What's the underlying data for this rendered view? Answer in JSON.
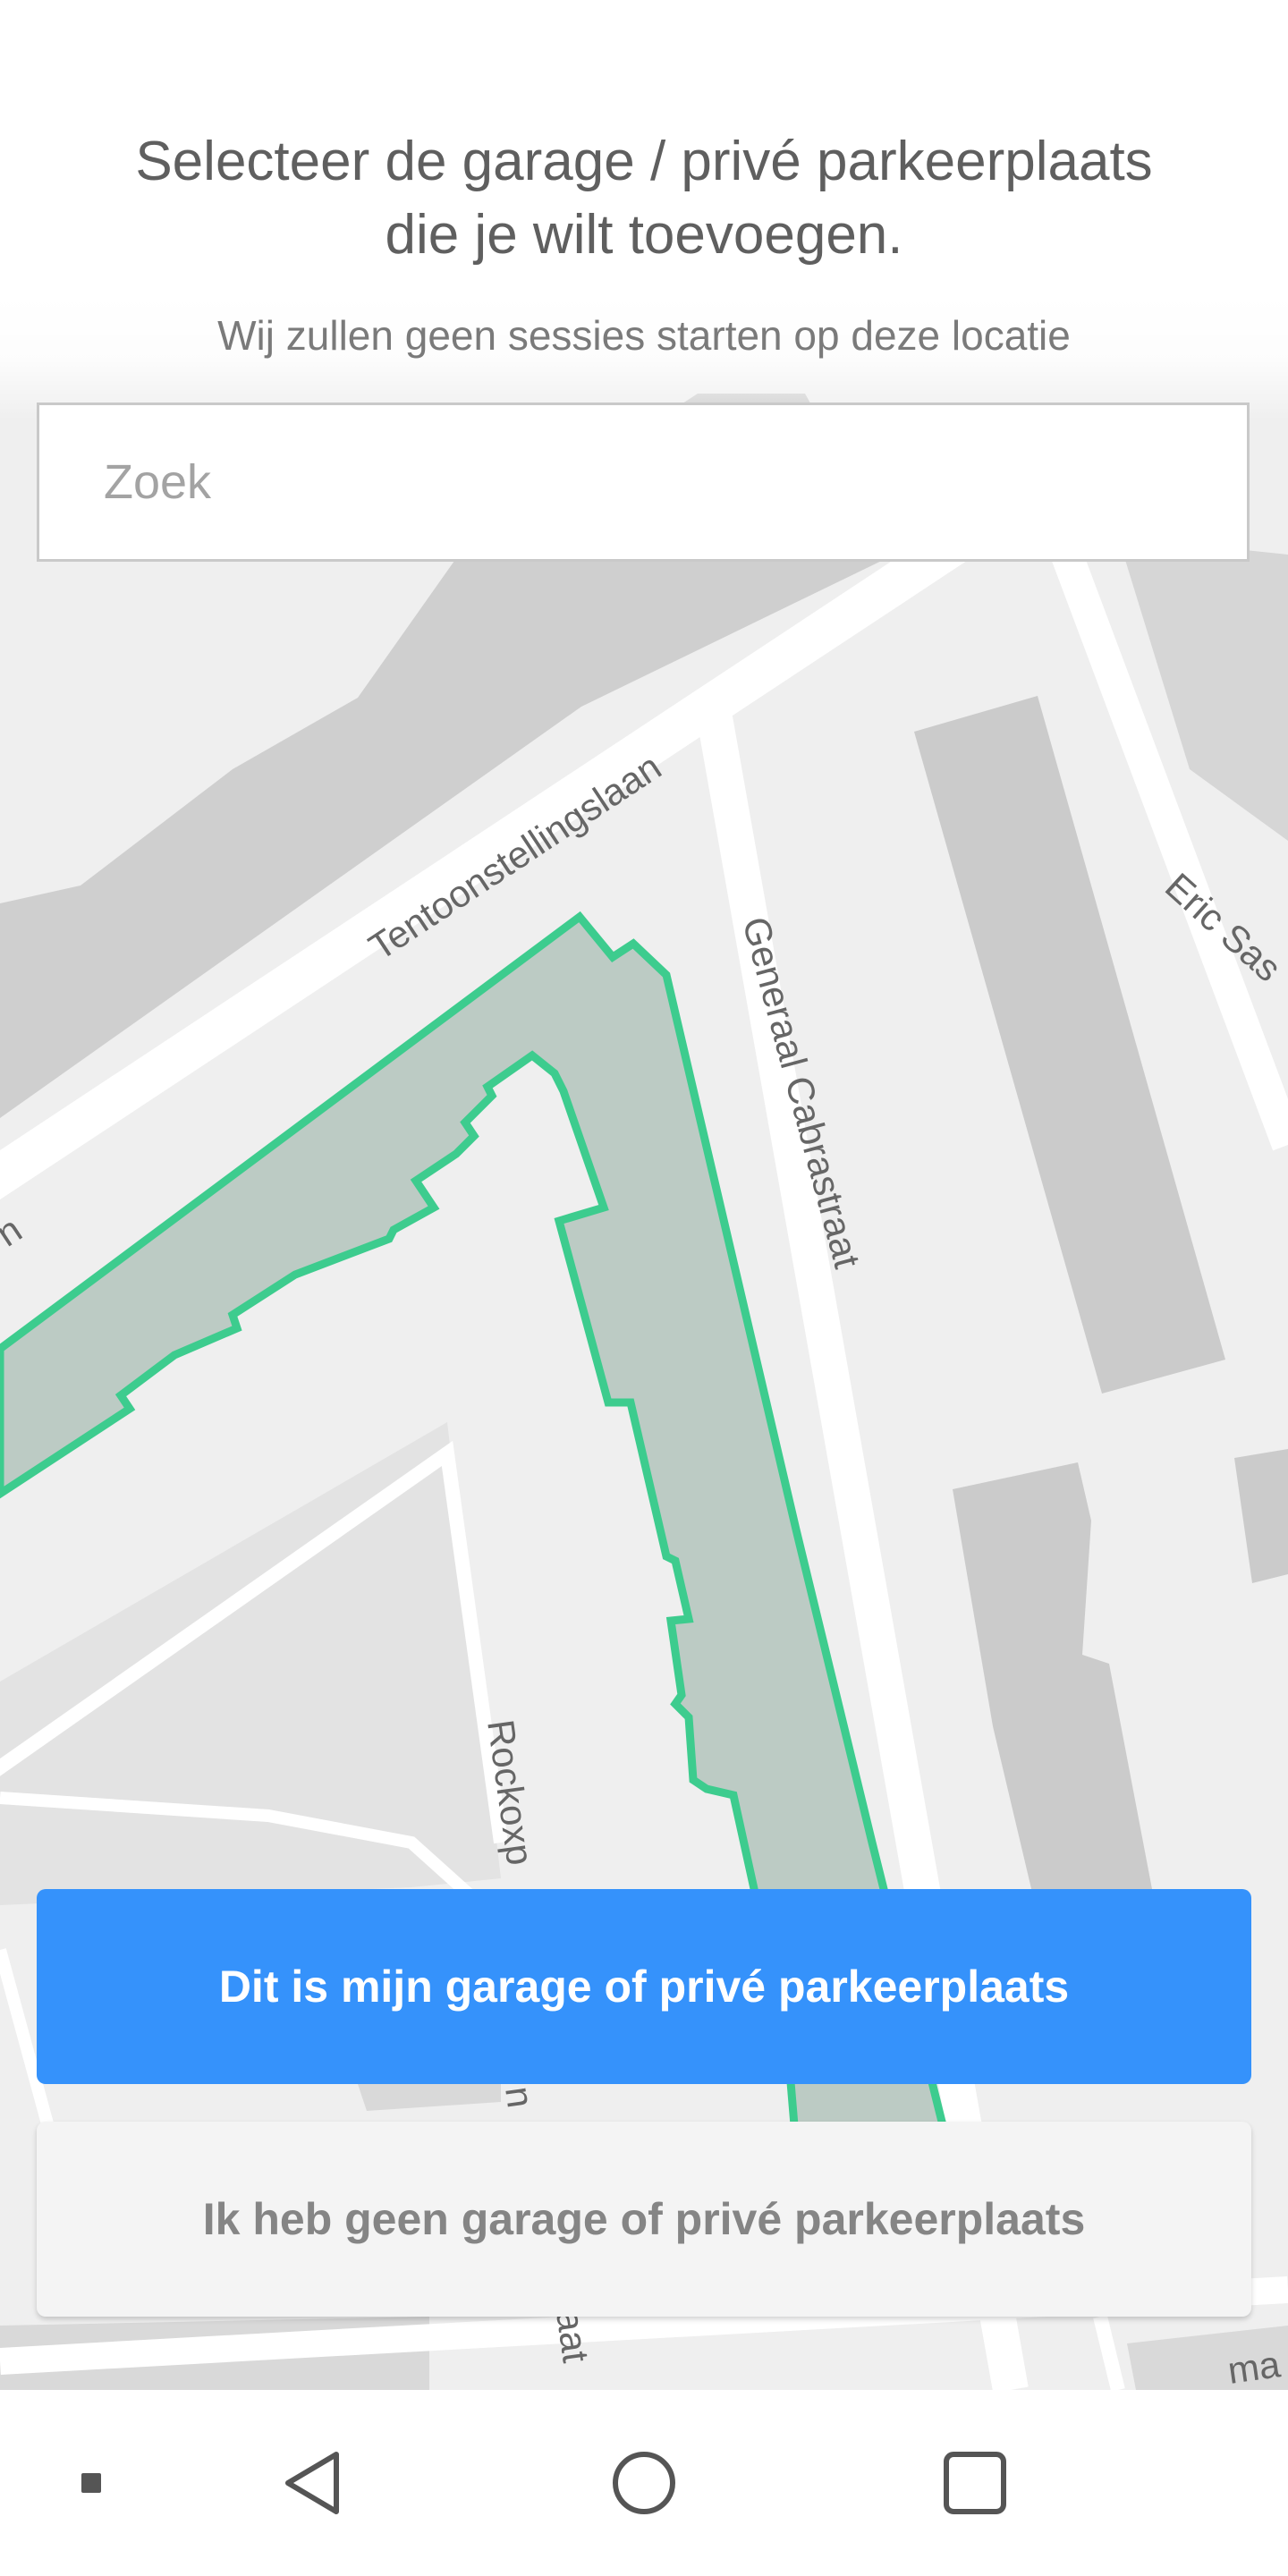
{
  "header": {
    "title_line1": "Selecteer de garage / privé parkeerplaats",
    "title_line2": "die je wilt toevoegen.",
    "subtitle": "Wij zullen geen sessies starten op deze locatie"
  },
  "search": {
    "placeholder": "Zoek",
    "value": ""
  },
  "map": {
    "streets": {
      "tentoonstellingslaan": "Tentoonstellingslaan",
      "generaal_cabrastraat": "Generaal Cabrastraat",
      "eric_sas": "Eric Sas",
      "rockoxp": "Rockoxp",
      "left_fragment": "n",
      "bottom_fragment_1": "n",
      "bottom_fragment_2": "aat",
      "right_bottom_fragment": "ma"
    },
    "colors": {
      "selection_outline": "#3dcc8e",
      "selection_fill": "#bccbc4",
      "marker": "#3592fb",
      "building": "#cfcfcf",
      "road": "#ffffff"
    },
    "marker_icon": "garage-car-icon"
  },
  "actions": {
    "primary_label": "Dit is mijn garage of privé parkeerplaats",
    "secondary_label": "Ik heb geen garage of privé parkeerplaats"
  },
  "navbar": {
    "icons": [
      "menu-square-icon",
      "back-icon",
      "home-icon",
      "recents-icon"
    ]
  }
}
